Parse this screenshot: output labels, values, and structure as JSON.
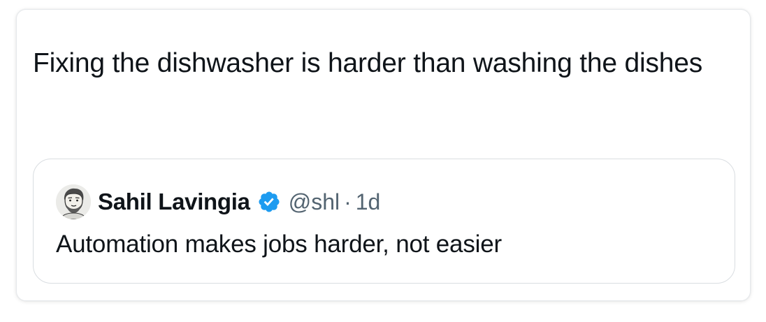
{
  "post": {
    "text": "Fixing the dishwasher is harder than washing the dishes"
  },
  "quoted": {
    "author_name": "Sahil Lavingia",
    "handle": "@shl",
    "separator": "·",
    "time": "1d",
    "text": "Automation makes jobs harder, not easier",
    "verified_icon": "verified-badge-icon",
    "verified_color": "#1d9bf0"
  },
  "colors": {
    "text_primary": "#0f1419",
    "text_secondary": "#536471",
    "border": "#d9dde1"
  }
}
